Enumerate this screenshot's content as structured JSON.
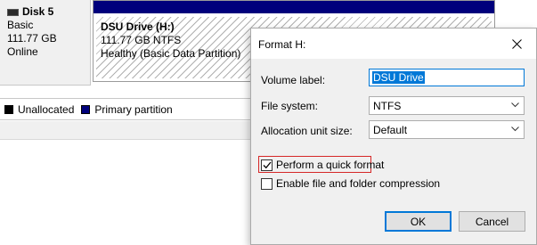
{
  "disk": {
    "name": "Disk 5",
    "type": "Basic",
    "size": "111.77 GB",
    "status": "Online"
  },
  "partition": {
    "name": "DSU Drive  (H:)",
    "size_fs": "111.77 GB NTFS",
    "health": "Healthy (Basic Data Partition)"
  },
  "legend": {
    "unallocated": "Unallocated",
    "primary": "Primary partition"
  },
  "dialog": {
    "title": "Format H:",
    "volume_label_label": "Volume label:",
    "volume_label_value": "DSU Drive",
    "file_system_label": "File system:",
    "file_system_value": "NTFS",
    "allocation_label": "Allocation unit size:",
    "allocation_value": "Default",
    "quick_format_label": "Perform a quick format",
    "quick_format_checked": true,
    "compression_label": "Enable file and folder compression",
    "compression_checked": false,
    "ok_label": "OK",
    "cancel_label": "Cancel"
  },
  "colors": {
    "primary_partition": "#00007c",
    "highlight": "#d62828",
    "focus": "#0078d7"
  }
}
